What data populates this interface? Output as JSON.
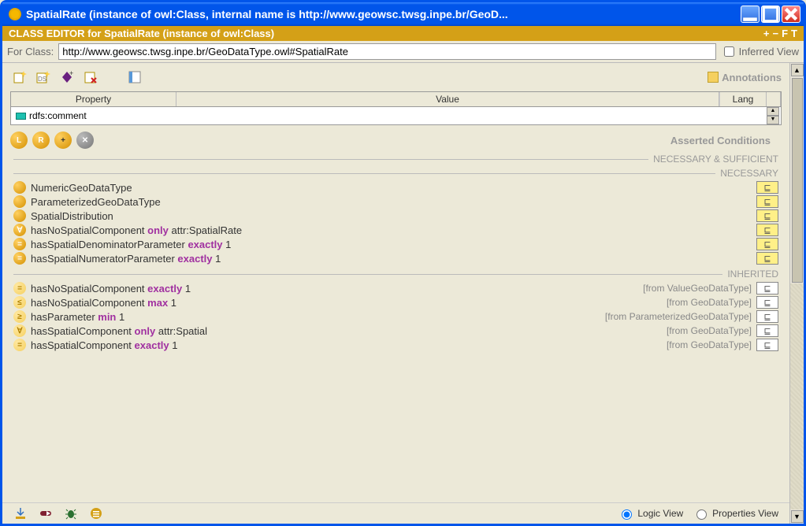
{
  "window": {
    "title": "SpatialRate   (instance of owl:Class, internal name is http://www.geowsc.twsg.inpe.br/GeoD..."
  },
  "header": {
    "text": "CLASS EDITOR for SpatialRate   (instance of owl:Class)"
  },
  "for_class": {
    "label": "For Class:",
    "value": "http://www.geowsc.twsg.inpe.br/GeoDataType.owl#SpatialRate",
    "inferred_view_label": "Inferred View"
  },
  "annotations": {
    "label": "Annotations",
    "table": {
      "headers": {
        "property": "Property",
        "value": "Value",
        "lang": "Lang"
      },
      "row": {
        "property": "rdfs:comment",
        "value": "",
        "lang": ""
      }
    }
  },
  "asserted": {
    "label": "Asserted Conditions",
    "sections": {
      "nec_suf": "NECESSARY & SUFFICIENT",
      "necessary": "NECESSARY",
      "inherited": "INHERITED"
    },
    "necessary": [
      {
        "icon": "class",
        "expr": "NumericGeoDataType"
      },
      {
        "icon": "class",
        "expr": "ParameterizedGeoDataType"
      },
      {
        "icon": "class",
        "expr": "SpatialDistribution"
      },
      {
        "icon": "forall",
        "prop": "hasNoSpatialComponent",
        "kw": "only",
        "rest": "attr:SpatialRate"
      },
      {
        "icon": "eq",
        "prop": "hasSpatialDenominatorParameter",
        "kw": "exactly",
        "rest": "1"
      },
      {
        "icon": "eq",
        "prop": "hasSpatialNumeratorParameter",
        "kw": "exactly",
        "rest": "1"
      }
    ],
    "inherited": [
      {
        "icon": "eq",
        "prop": "hasNoSpatialComponent",
        "kw": "exactly",
        "rest": "1",
        "from": "[from ValueGeoDataType]"
      },
      {
        "icon": "le",
        "prop": "hasNoSpatialComponent",
        "kw": "max",
        "rest": "1",
        "from": "[from GeoDataType]"
      },
      {
        "icon": "ge",
        "prop": "hasParameter",
        "kw": "min",
        "rest": "1",
        "from": "[from ParameterizedGeoDataType]"
      },
      {
        "icon": "forall",
        "prop": "hasSpatialComponent",
        "kw": "only",
        "rest": "attr:Spatial",
        "from": "[from GeoDataType]"
      },
      {
        "icon": "eq",
        "prop": "hasSpatialComponent",
        "kw": "exactly",
        "rest": "1",
        "from": "[from GeoDataType]"
      }
    ]
  },
  "bottom": {
    "logic_view": "Logic View",
    "properties_view": "Properties View",
    "selected": "logic"
  },
  "subset_glyph": "⊑"
}
